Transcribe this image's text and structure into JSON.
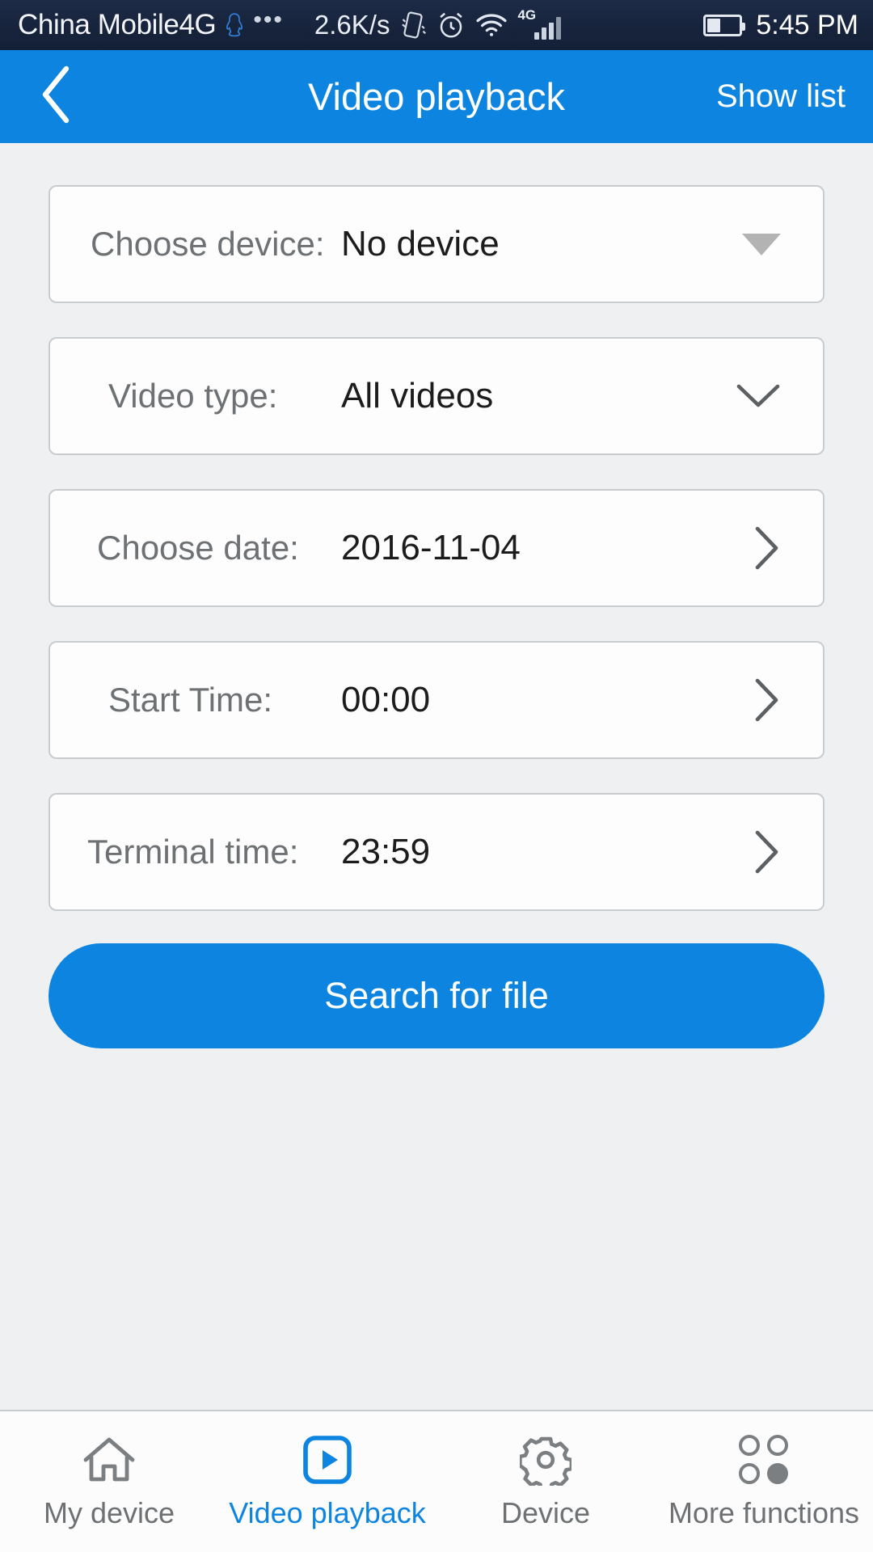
{
  "status_bar": {
    "carrier": "China Mobile4G",
    "qq_icon": "qq-penguin-icon",
    "overflow_icon": "ellipsis-icon",
    "network_speed": "2.6K/s",
    "vibrate_icon": "vibrate-icon",
    "alarm_icon": "alarm-clock-icon",
    "wifi_icon": "wifi-icon",
    "network_type": "4G",
    "signal_icon": "signal-bars-icon",
    "battery_icon": "battery-icon",
    "clock": "5:45 PM"
  },
  "header": {
    "back_icon": "chevron-left-icon",
    "title": "Video playback",
    "action_label": "Show list"
  },
  "form": {
    "rows": [
      {
        "label": "Choose device:",
        "value": "No device",
        "indicator": "triangle-down-icon"
      },
      {
        "label": "Video type:",
        "value": "All videos",
        "indicator": "chevron-down-icon"
      },
      {
        "label": "Choose date:",
        "value": "2016-11-04",
        "indicator": "chevron-right-icon"
      },
      {
        "label": "Start Time:",
        "value": "00:00",
        "indicator": "chevron-right-icon"
      },
      {
        "label": "Terminal time:",
        "value": "23:59",
        "indicator": "chevron-right-icon"
      }
    ],
    "submit_label": "Search for file"
  },
  "tabbar": {
    "items": [
      {
        "label": "My device",
        "icon": "home-icon",
        "active": false
      },
      {
        "label": "Video playback",
        "icon": "play-square-icon",
        "active": true
      },
      {
        "label": "Device",
        "icon": "gear-icon",
        "active": false
      },
      {
        "label": "More functions",
        "icon": "four-circles-icon",
        "active": false
      }
    ]
  },
  "colors": {
    "accent": "#0d85e0",
    "page_background": "#eef0f1",
    "card_background": "#fdfdfd",
    "card_border": "#c9cccf",
    "label_text": "#6d7174",
    "value_text": "#1c1c1c",
    "statusbar_background": "#17233b"
  }
}
